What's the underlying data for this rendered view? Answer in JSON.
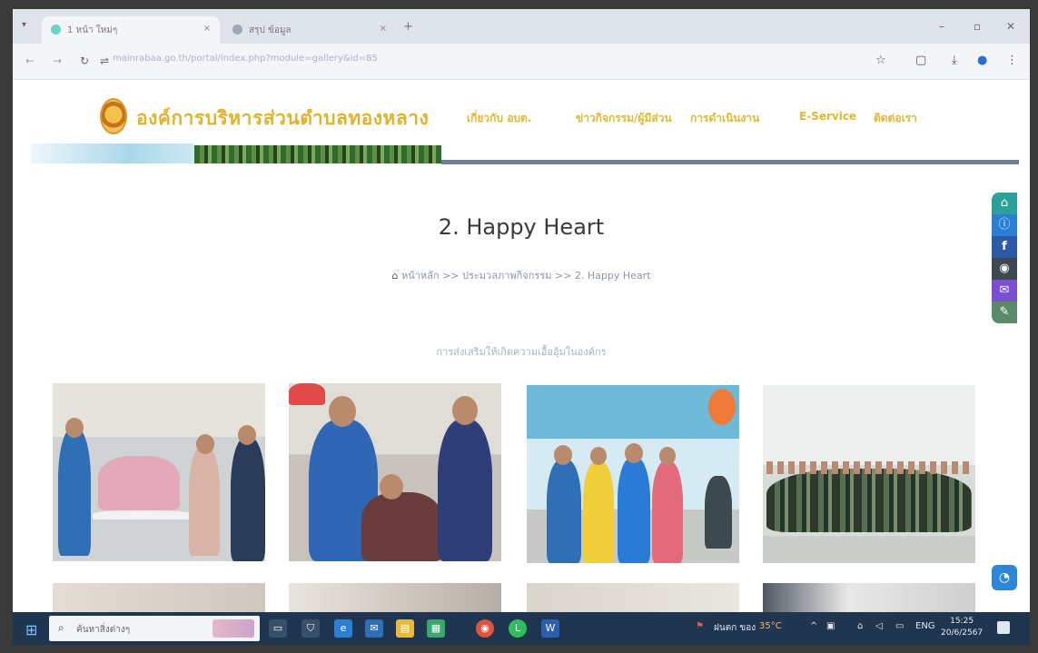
{
  "browser": {
    "tabs": [
      {
        "label": "1 หน้า ใหม่ๆ",
        "active": true
      },
      {
        "label": "สรุป ข้อมูล",
        "active": false
      }
    ],
    "url": "mainrabaa.go.th/portal/index.php?module=gallery&id=85",
    "new_tab_glyph": "+",
    "close_glyph": "×"
  },
  "site": {
    "name": "องค์การบริหารส่วนตำบลทองหลาง",
    "menu": [
      "เกี่ยวกับ อบต.",
      "ข่าวกิจกรรม/ผู้มีส่วน",
      "การดำเนินงาน",
      "E-Service",
      "ติดต่อเรา"
    ]
  },
  "page": {
    "title": "2. Happy Heart",
    "breadcrumb": {
      "home": "หน้าหลัก",
      "separator": ">>",
      "section": "ประมวลภาพกิจกรรม",
      "current": "2. Happy Heart"
    },
    "subtitle": "การส่งเสริมให้เกิดความเอื้ออุ้มในองค์กร"
  },
  "side_buttons": [
    {
      "icon": "home-icon",
      "glyph": "⌂",
      "color": "#2aa19b"
    },
    {
      "icon": "info-icon",
      "glyph": "ⓘ",
      "color": "#2a7fd4"
    },
    {
      "icon": "facebook-icon",
      "glyph": "f",
      "color": "#2c5aa6"
    },
    {
      "icon": "user-icon",
      "glyph": "◉",
      "color": "#3d4852"
    },
    {
      "icon": "mail-icon",
      "glyph": "✉",
      "color": "#7a4fd0"
    },
    {
      "icon": "edit-icon",
      "glyph": "✎",
      "color": "#5b8a6a"
    }
  ],
  "taskbar": {
    "search_placeholder": "ค้นหาสิ่งต่างๆ",
    "weather": "ฝนตก ของ",
    "temp": "35°C",
    "lang": "ENG",
    "time": "15:25",
    "date": "20/6/2567"
  }
}
